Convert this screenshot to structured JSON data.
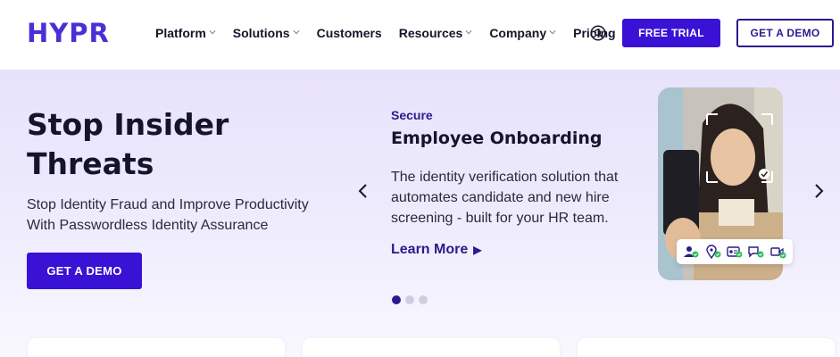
{
  "header": {
    "logo": "HYPR",
    "nav": [
      {
        "label": "Platform",
        "has_dropdown": true
      },
      {
        "label": "Solutions",
        "has_dropdown": true
      },
      {
        "label": "Customers",
        "has_dropdown": false
      },
      {
        "label": "Resources",
        "has_dropdown": true
      },
      {
        "label": "Company",
        "has_dropdown": true
      },
      {
        "label": "Pricing",
        "has_dropdown": false
      }
    ],
    "search_icon": "search-icon",
    "free_trial_label": "FREE TRIAL",
    "get_demo_label": "GET A DEMO"
  },
  "hero": {
    "title": "Stop Insider Threats",
    "subtitle": "Stop Identity Fraud and Improve Productivity With Passwordless Identity Assurance",
    "cta_label": "GET A DEMO"
  },
  "carousel": {
    "eyebrow": "Secure",
    "title": "Employee Onboarding",
    "description": "The identity verification solution that automates candidate and new hire screening - built for your HR team.",
    "link_label": "Learn More",
    "slide_count": 3,
    "active_index": 0,
    "badge_icons": [
      "user-check-icon",
      "location-check-icon",
      "id-card-check-icon",
      "chat-check-icon",
      "video-check-icon"
    ]
  },
  "colors": {
    "brand": "#4b2fd6",
    "button": "#3a12d6",
    "navy": "#2b1a8e",
    "check": "#2fbf5a"
  }
}
